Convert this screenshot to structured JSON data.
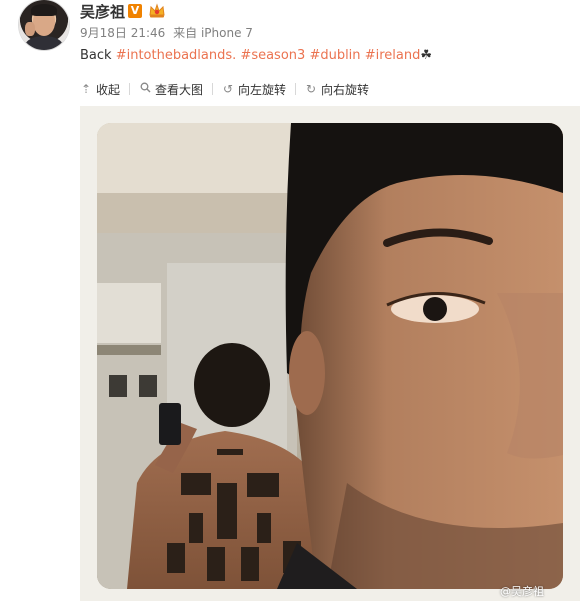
{
  "post": {
    "user_name": "吴彦祖",
    "verified_label": "V",
    "date": "9月18日 21:46",
    "source": "来自 iPhone 7",
    "text_prefix": "Back ",
    "tags": [
      "#intothebadlands.",
      "#season3",
      "#dublin",
      "#ireland"
    ],
    "text_suffix": "☘"
  },
  "toolbar": {
    "collapse_label": "收起",
    "collapse_icon": "arrow-up-icon",
    "view_large_label": "查看大图",
    "view_large_icon": "zoom-icon",
    "rotate_left_label": "向左旋转",
    "rotate_left_icon": "rotate-left-icon",
    "rotate_right_label": "向右旋转",
    "rotate_right_icon": "rotate-right-icon"
  },
  "media": {
    "watermark": "@吴彦祖"
  },
  "colors": {
    "link": "#eb7350",
    "name": "#333333",
    "meta": "#808080",
    "verified": "#f08200"
  }
}
